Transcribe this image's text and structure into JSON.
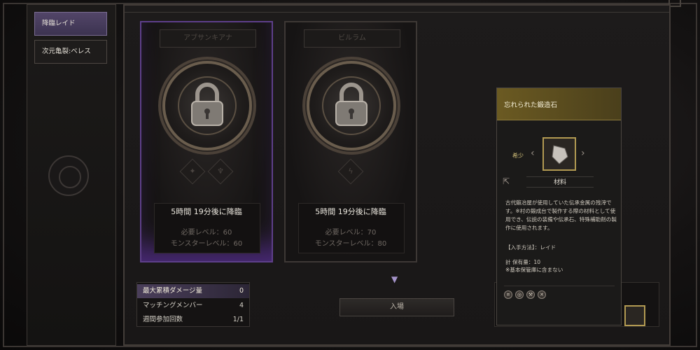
{
  "sidebar": {
    "items": [
      {
        "label": "降臨レイド"
      },
      {
        "label": "次元亀裂:ベレス"
      }
    ]
  },
  "raids": [
    {
      "name": "アブサンキアナ",
      "countdown": "5時間 19分後に降臨",
      "required_level": "必要レベル：60",
      "monster_level": "モンスターレベル：60"
    },
    {
      "name": "ビルラム",
      "countdown": "5時間 19分後に降臨",
      "required_level": "必要レベル：70",
      "monster_level": "モンスターレベル：80"
    }
  ],
  "stats": [
    {
      "label": "最大累積ダメージ量",
      "value": "0"
    },
    {
      "label": "マッチングメンバー",
      "value": "4"
    },
    {
      "label": "週間参加回数",
      "value": "1/1"
    }
  ],
  "enter_button": {
    "label": "入場"
  },
  "tooltip": {
    "title": "忘れられた鍛造石",
    "rarity": "希少",
    "category": "材料",
    "description": "古代鍛冶屋が使用していた伝承金属の残滓です。※村の鍛成台で製作する際の材料として使用でき、伝説の装備や伝承石、特殊補助剤の製作に使用されます。",
    "how_to_get": "【入手方法】：レイド",
    "owned": "計 保有量：10",
    "owned_note": "※基本保管庫に含まない"
  },
  "colors": {
    "accent_purple": "#5e3f8a",
    "gold": "#b29a52"
  }
}
